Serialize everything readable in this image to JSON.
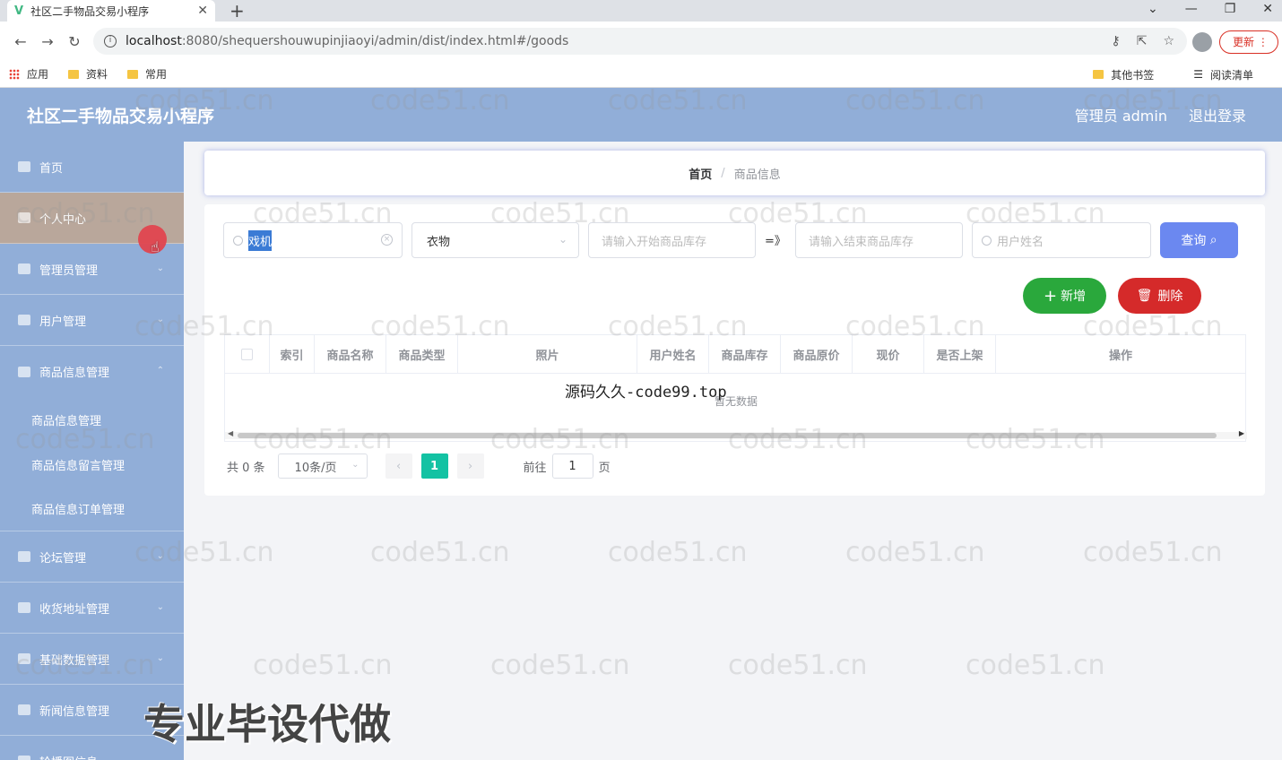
{
  "browser": {
    "tab_title": "社区二手物品交易小程序",
    "url_host": "localhost",
    "url_rest": ":8080/shequershouwupinjiaoyi/admin/dist/index.html#/goods",
    "update_label": "更新",
    "bookmarks": [
      "应用",
      "资料",
      "常用"
    ],
    "bookmarks_right": [
      "其他书签",
      "阅读清单"
    ]
  },
  "app": {
    "title": "社区二手物品交易小程序",
    "user_label": "管理员 admin",
    "logout_label": "退出登录"
  },
  "sidebar": {
    "items": [
      {
        "label": "首页",
        "icon": "home-icon"
      },
      {
        "label": "个人中心",
        "icon": "user-icon"
      },
      {
        "label": "管理员管理",
        "icon": "briefcase-icon"
      },
      {
        "label": "用户管理",
        "icon": "users-icon"
      },
      {
        "label": "商品信息管理",
        "icon": "user-icon"
      }
    ],
    "sub_items": [
      "商品信息管理",
      "商品信息留言管理",
      "商品信息订单管理"
    ],
    "items_after": [
      {
        "label": "论坛管理",
        "icon": "list-icon"
      },
      {
        "label": "收货地址管理",
        "icon": "grid-icon"
      },
      {
        "label": "基础数据管理",
        "icon": "flag-icon"
      },
      {
        "label": "新闻信息管理",
        "icon": "power-icon"
      },
      {
        "label": "轮播图信息",
        "icon": "image-icon"
      }
    ]
  },
  "breadcrumb": {
    "home": "首页",
    "sep": "/",
    "current": "商品信息"
  },
  "filters": {
    "name_value": "戏机",
    "type_value": "衣物",
    "stock_start_placeholder": "请输入开始商品库存",
    "range_sep": "=》",
    "stock_end_placeholder": "请输入结束商品库存",
    "username_placeholder": "用户姓名",
    "query_label": "查询"
  },
  "actions": {
    "add_label": "新增",
    "delete_label": "删除"
  },
  "table": {
    "columns": [
      "索引",
      "商品名称",
      "商品类型",
      "照片",
      "用户姓名",
      "商品库存",
      "商品原价",
      "现价",
      "是否上架",
      "操作"
    ],
    "empty_text": "暂无数据"
  },
  "pagination": {
    "total_label": "共 0 条",
    "page_size": "10条/页",
    "current_page": "1",
    "jump_label": "前往",
    "jump_value": "1",
    "page_unit": "页"
  },
  "overlays": {
    "code_text": "源码久久-code99.top",
    "big_text": "专业毕设代做",
    "watermark": "code51.cn"
  },
  "colors": {
    "header_bg": "#91aed8",
    "active_menu": "#b9a79b",
    "query_btn": "#6b88f0",
    "add_btn": "#2aa83c",
    "delete_btn": "#d52a2a",
    "page_active": "#13c2a3"
  }
}
